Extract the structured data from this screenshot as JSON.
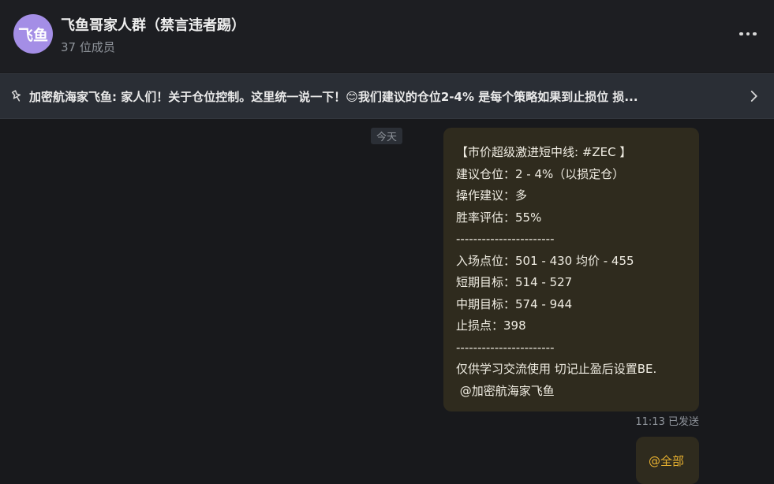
{
  "header": {
    "avatar_text": "飞鱼",
    "title": "飞鱼哥家人群（禁言违者踢）",
    "member_count": "37 位成员",
    "more_icon": "more-horizontal-icon"
  },
  "pinned": {
    "icon": "pin-icon",
    "text": "加密航海家飞鱼: 家人们！关于仓位控制。这里统一说一下！😊我们建议的仓位2-4% 是每个策略如果到止损位 损...",
    "chevron_icon": "chevron-right-icon"
  },
  "chat": {
    "date_label": "今天",
    "messages": [
      {
        "lines": [
          "【市价超级激进短中线: #ZEC 】",
          "建议仓位：2 - 4%（以损定仓）",
          "操作建议：多",
          "胜率评估：55%",
          "-----------------------",
          "入场点位：501 - 430 均价 - 455",
          "短期目标：514 - 527",
          "中期目标：574 - 944",
          "止损点：398",
          "-----------------------",
          "仅供学习交流使用 切记止盈后设置BE.",
          " @加密航海家飞鱼"
        ],
        "time": "11:13",
        "status": "已发送"
      },
      {
        "text": "@全部"
      }
    ]
  },
  "colors": {
    "background": "#18191c",
    "bubble": "#2f2b1e",
    "mention": "#e8b130",
    "avatar": "#a48ee6"
  }
}
